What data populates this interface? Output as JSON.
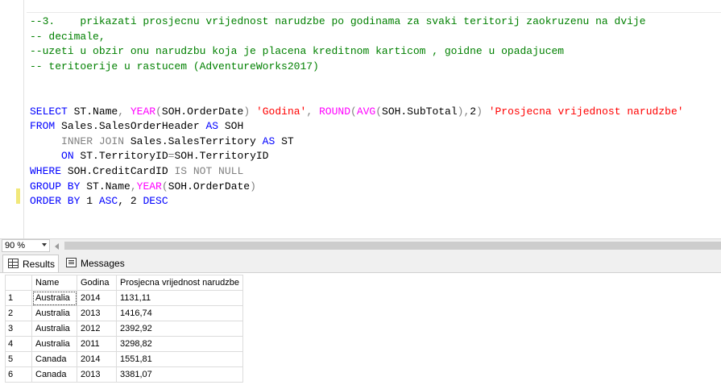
{
  "editor": {
    "lines": [
      [
        {
          "t": "--3.    prikazati prosjecnu vrijednost narudzbe po godinama za svaki teritorij zaokruzenu na dvije",
          "c": "cm"
        }
      ],
      [
        {
          "t": "-- decimale,",
          "c": "cm"
        }
      ],
      [
        {
          "t": "--uzeti u obzir onu narudzbu koja je placena kreditnom karticom , goidne u opadajucem",
          "c": "cm"
        }
      ],
      [
        {
          "t": "-- teritoerije u rastucem (AdventureWorks2017)",
          "c": "cm"
        }
      ],
      [],
      [],
      [
        {
          "t": "SELECT",
          "c": "kw"
        },
        {
          "t": " ST.Name",
          "c": "plain"
        },
        {
          "t": ",",
          "c": "gr"
        },
        {
          "t": " ",
          "c": "plain"
        },
        {
          "t": "YEAR",
          "c": "fn"
        },
        {
          "t": "(",
          "c": "gr"
        },
        {
          "t": "SOH.OrderDate",
          "c": "plain"
        },
        {
          "t": ")",
          "c": "gr"
        },
        {
          "t": " ",
          "c": "plain"
        },
        {
          "t": "'Godina'",
          "c": "st"
        },
        {
          "t": ",",
          "c": "gr"
        },
        {
          "t": " ",
          "c": "plain"
        },
        {
          "t": "ROUND",
          "c": "fn"
        },
        {
          "t": "(",
          "c": "gr"
        },
        {
          "t": "AVG",
          "c": "fn"
        },
        {
          "t": "(",
          "c": "gr"
        },
        {
          "t": "SOH.SubTotal",
          "c": "plain"
        },
        {
          "t": "),",
          "c": "gr"
        },
        {
          "t": "2",
          "c": "plain"
        },
        {
          "t": ")",
          "c": "gr"
        },
        {
          "t": " ",
          "c": "plain"
        },
        {
          "t": "'Prosjecna vrijednost narudzbe'",
          "c": "st"
        }
      ],
      [
        {
          "t": "FROM",
          "c": "kw"
        },
        {
          "t": " Sales.SalesOrderHeader ",
          "c": "plain"
        },
        {
          "t": "AS",
          "c": "kw"
        },
        {
          "t": " SOH",
          "c": "plain"
        }
      ],
      [
        {
          "t": "     ",
          "c": "plain"
        },
        {
          "t": "INNER JOIN",
          "c": "gr"
        },
        {
          "t": " Sales.SalesTerritory ",
          "c": "plain"
        },
        {
          "t": "AS",
          "c": "kw"
        },
        {
          "t": " ST",
          "c": "plain"
        }
      ],
      [
        {
          "t": "     ",
          "c": "plain"
        },
        {
          "t": "ON",
          "c": "kw"
        },
        {
          "t": " ST.TerritoryID",
          "c": "plain"
        },
        {
          "t": "=",
          "c": "gr"
        },
        {
          "t": "SOH.TerritoryID",
          "c": "plain"
        }
      ],
      [
        {
          "t": "WHERE",
          "c": "kw"
        },
        {
          "t": " SOH.CreditCardID ",
          "c": "plain"
        },
        {
          "t": "IS NOT NULL",
          "c": "gr"
        }
      ],
      [
        {
          "t": "GROUP BY",
          "c": "kw"
        },
        {
          "t": " ST.Name",
          "c": "plain"
        },
        {
          "t": ",",
          "c": "gr"
        },
        {
          "t": "YEAR",
          "c": "fn"
        },
        {
          "t": "(",
          "c": "gr"
        },
        {
          "t": "SOH.OrderDate",
          "c": "plain"
        },
        {
          "t": ")",
          "c": "gr"
        }
      ],
      [
        {
          "t": "ORDER BY",
          "c": "kw"
        },
        {
          "t": " 1 ",
          "c": "plain"
        },
        {
          "t": "ASC",
          "c": "kw"
        },
        {
          "t": ", 2 ",
          "c": "plain"
        },
        {
          "t": "DESC",
          "c": "kw"
        }
      ]
    ]
  },
  "zoom": {
    "value": "90 %"
  },
  "tabs": [
    {
      "label": "Results",
      "icon": "grid-icon",
      "active": true
    },
    {
      "label": "Messages",
      "icon": "messages-icon",
      "active": false
    }
  ],
  "results": {
    "columns": [
      "Name",
      "Godina",
      "Prosjecna vrijednost narudzbe"
    ],
    "rows": [
      {
        "n": "1",
        "cells": [
          "Australia",
          "2014",
          "1131,11"
        ]
      },
      {
        "n": "2",
        "cells": [
          "Australia",
          "2013",
          "1416,74"
        ]
      },
      {
        "n": "3",
        "cells": [
          "Australia",
          "2012",
          "2392,92"
        ]
      },
      {
        "n": "4",
        "cells": [
          "Australia",
          "2011",
          "3298,82"
        ]
      },
      {
        "n": "5",
        "cells": [
          "Canada",
          "2014",
          "1551,81"
        ]
      },
      {
        "n": "6",
        "cells": [
          "Canada",
          "2013",
          "3381,07"
        ]
      }
    ]
  }
}
